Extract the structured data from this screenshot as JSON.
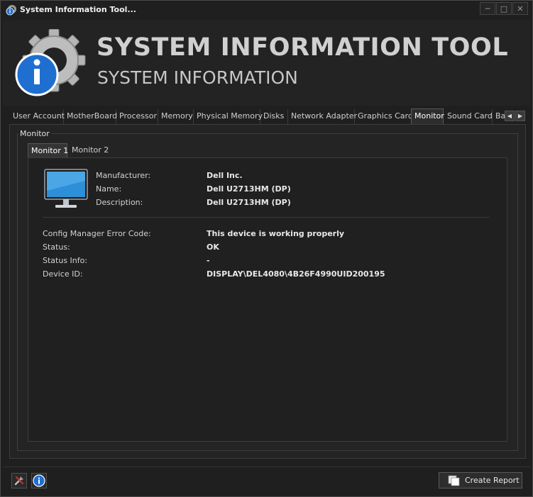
{
  "window": {
    "title": "System Information Tool...",
    "controls": {
      "minimize": "─",
      "maximize": "□",
      "close": "✕"
    }
  },
  "banner": {
    "title": "SYSTEM INFORMATION TOOL",
    "subtitle": "SYSTEM INFORMATION"
  },
  "tabs": [
    {
      "label": "User Account"
    },
    {
      "label": "MotherBoard"
    },
    {
      "label": "Processor"
    },
    {
      "label": "Memory"
    },
    {
      "label": "Physical Memory"
    },
    {
      "label": "Disks"
    },
    {
      "label": "Network Adapter"
    },
    {
      "label": "Graphics Card"
    },
    {
      "label": "Monitor"
    },
    {
      "label": "Sound Card"
    },
    {
      "label": "Ba"
    }
  ],
  "active_tab": "Monitor",
  "group_label": "Monitor",
  "subtabs": [
    {
      "label": "Monitor 1"
    },
    {
      "label": "Monitor 2"
    }
  ],
  "active_subtab": "Monitor 1",
  "monitor": {
    "manufacturer_label": "Manufacturer:",
    "manufacturer": "Dell Inc.",
    "name_label": "Name:",
    "name": "Dell U2713HM (DP)",
    "description_label": "Description:",
    "description": "Dell U2713HM (DP)",
    "error_code_label": "Config Manager Error Code:",
    "error_code": "This device is working properly",
    "status_label": "Status:",
    "status": "OK",
    "status_info_label": "Status Info:",
    "status_info": "-",
    "device_id_label": "Device ID:",
    "device_id": "DISPLAY\\DEL4080\\4B26F4990UID200195"
  },
  "footer": {
    "create_report_label": "Create Report"
  },
  "colors": {
    "background": "#1f1f1f",
    "logo_blue": "#1e6fd0",
    "gear_gray": "#b8b8b8"
  }
}
